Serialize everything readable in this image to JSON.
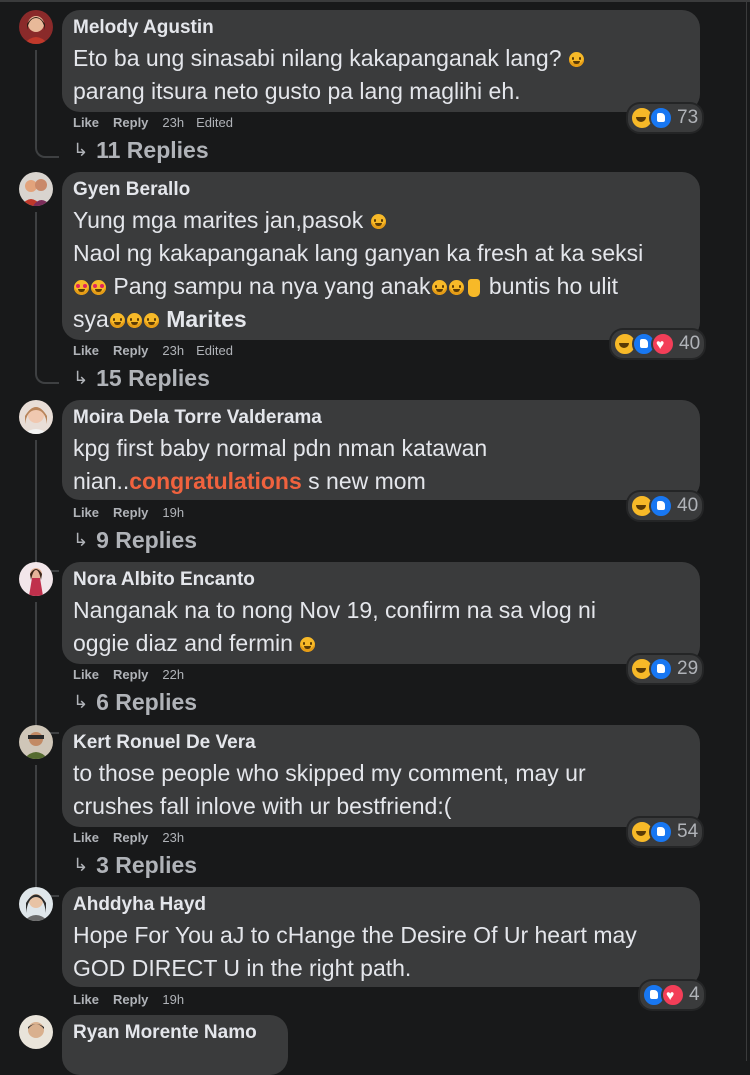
{
  "comments": [
    {
      "author": "Melody Agustin",
      "line1": "Eto ba ung sinasabi nilang kakapanganak lang?",
      "line2": "parang itsura neto gusto pa lang maglihi eh.",
      "like": "Like",
      "reply": "Reply",
      "time": "23h",
      "edited": "Edited",
      "reaction_count": "73",
      "replies": "11 Replies"
    },
    {
      "author": "Gyen Berallo",
      "line1": "Yung mga marites jan,pasok",
      "line2": "Naol ng kakapanganak lang ganyan ka fresh at ka seksi",
      "line3a": "Pang sampu na nya yang anak",
      "line3b": "buntis ho ulit",
      "line4a": "sya",
      "line4b": "Marites",
      "like": "Like",
      "reply": "Reply",
      "time": "23h",
      "edited": "Edited",
      "reaction_count": "40",
      "replies": "15 Replies"
    },
    {
      "author": "Moira Dela Torre Valderama",
      "line1": "kpg first baby normal pdn nman katawan",
      "line2a": "nian..",
      "line2b": "congratulations",
      "line2c": " s new mom",
      "like": "Like",
      "reply": "Reply",
      "time": "19h",
      "reaction_count": "40",
      "replies": "9 Replies"
    },
    {
      "author": "Nora Albito Encanto",
      "line1": "Nanganak na to nong Nov 19, confirm na sa vlog ni",
      "line2": "oggie diaz and fermin",
      "like": "Like",
      "reply": "Reply",
      "time": "22h",
      "reaction_count": "29",
      "replies": "6 Replies"
    },
    {
      "author": "Kert Ronuel De Vera",
      "line1": "to those people who skipped my comment, may ur",
      "line2": "crushes fall inlove with ur bestfriend:(",
      "like": "Like",
      "reply": "Reply",
      "time": "23h",
      "reaction_count": "54",
      "replies": "3 Replies"
    },
    {
      "author": "Ahddyha Hayd",
      "line1": "Hope For You aJ to cHange the Desire Of Ur heart may",
      "line2": "GOD DIRECT U in the right path.",
      "like": "Like",
      "reply": "Reply",
      "time": "19h",
      "reaction_count": "4"
    },
    {
      "author": "Ryan Morente Namo"
    }
  ],
  "icons": {
    "reply_arrow": "↳",
    "haha_color": "#f7b928",
    "like_color": "#1877f2",
    "love_color": "#f33e58"
  }
}
